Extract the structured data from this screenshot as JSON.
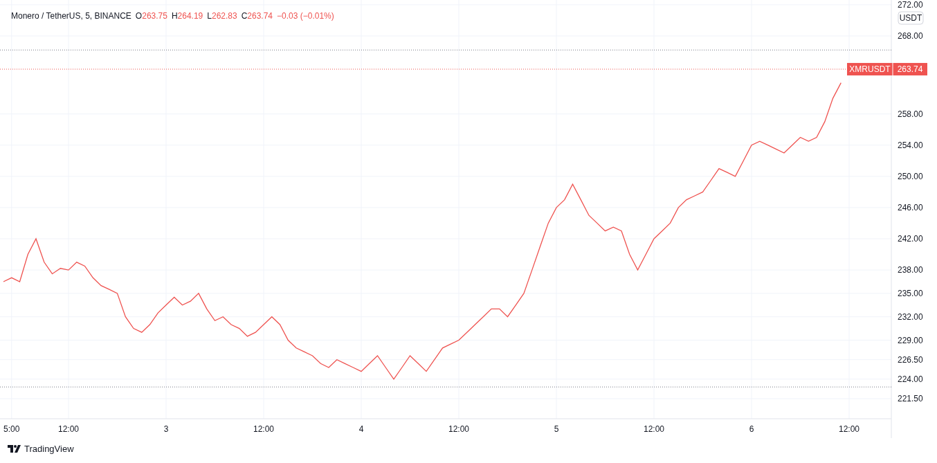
{
  "legend": {
    "symbol": "Monero / TetherUS, 5, BINANCE",
    "open_label": "O",
    "open": "263.75",
    "high_label": "H",
    "high": "264.19",
    "low_label": "L",
    "low": "262.83",
    "close_label": "C",
    "close": "263.74",
    "change": "−0.03 (−0.01%)"
  },
  "currency_button": "USDT",
  "price_tag": {
    "price": "263.74"
  },
  "chart_data": {
    "type": "line",
    "ylim": [
      218.93,
      272.61
    ],
    "grid": true,
    "ref_lines": [
      {
        "axis": "y",
        "value": 266.2,
        "color": "#787b86"
      },
      {
        "axis": "y",
        "value": 223,
        "color": "#787b86"
      },
      {
        "axis": "y",
        "value": 263.74,
        "color": "#ef5350"
      }
    ],
    "categories": [
      null,
      "5:00",
      null,
      null,
      null,
      null,
      null,
      null,
      "12:00",
      null,
      null,
      null,
      null,
      null,
      null,
      null,
      null,
      null,
      null,
      null,
      "3",
      null,
      null,
      null,
      null,
      null,
      null,
      null,
      null,
      null,
      null,
      null,
      "12:00",
      null,
      null,
      null,
      null,
      null,
      null,
      null,
      null,
      null,
      null,
      null,
      "4",
      null,
      null,
      null,
      null,
      null,
      null,
      null,
      null,
      null,
      null,
      null,
      "12:00",
      null,
      null,
      null,
      null,
      null,
      null,
      null,
      null,
      null,
      null,
      null,
      "5",
      null,
      null,
      null,
      null,
      null,
      null,
      null,
      null,
      null,
      null,
      null,
      "12:00",
      null,
      null,
      null,
      null,
      null,
      null,
      null,
      null,
      null,
      null,
      null,
      "6",
      null,
      null,
      null,
      null,
      null,
      null,
      null,
      null,
      null,
      null,
      null,
      "12:00",
      null,
      null,
      null,
      null
    ],
    "yticks": [
      {
        "value": 221.5,
        "label": "221.50"
      },
      {
        "value": 224,
        "label": "224.00"
      },
      {
        "value": 226.5,
        "label": "226.50"
      },
      {
        "value": 229,
        "label": "229.00"
      },
      {
        "value": 232,
        "label": "232.00"
      },
      {
        "value": 235,
        "label": "235.00"
      },
      {
        "value": 238,
        "label": "238.00"
      },
      {
        "value": 242,
        "label": "242.00"
      },
      {
        "value": 246,
        "label": "246.00"
      },
      {
        "value": 250,
        "label": "250.00"
      },
      {
        "value": 254,
        "label": "254.00"
      },
      {
        "value": 258,
        "label": "258.00"
      },
      {
        "value": 268,
        "label": "268.00"
      },
      {
        "value": 272,
        "label": "272.00"
      }
    ],
    "series": [
      {
        "name": "XMRUSDT",
        "color": "#ef5350",
        "values": [
          236.5,
          237,
          236.5,
          240,
          242,
          239,
          237.5,
          238.2,
          238,
          239,
          238.5,
          237,
          236,
          235.5,
          235,
          232,
          230.5,
          230,
          231,
          232.5,
          233.5,
          234.5,
          233.5,
          234,
          235,
          233,
          231.5,
          232,
          231,
          230.5,
          229.5,
          230,
          231,
          232,
          231,
          229,
          228,
          227.5,
          227,
          226,
          225.5,
          226.5,
          226,
          225.5,
          225,
          226,
          227,
          225.5,
          224,
          225.5,
          227,
          226,
          225,
          226.5,
          228,
          228.5,
          229,
          230,
          231,
          232,
          233,
          233,
          232,
          233.5,
          235,
          238,
          241,
          244,
          246,
          247,
          249,
          247,
          245,
          244,
          243,
          243.5,
          243,
          240,
          238,
          240,
          242,
          243,
          244,
          246,
          247,
          247.5,
          248,
          249.5,
          251,
          250.5,
          250,
          252,
          254,
          254.5,
          254,
          253.5,
          253,
          254,
          255,
          254.5,
          255,
          257,
          260,
          262,
          null,
          null,
          null,
          null,
          null
        ]
      }
    ]
  },
  "footer": {
    "brand": "TradingView"
  }
}
